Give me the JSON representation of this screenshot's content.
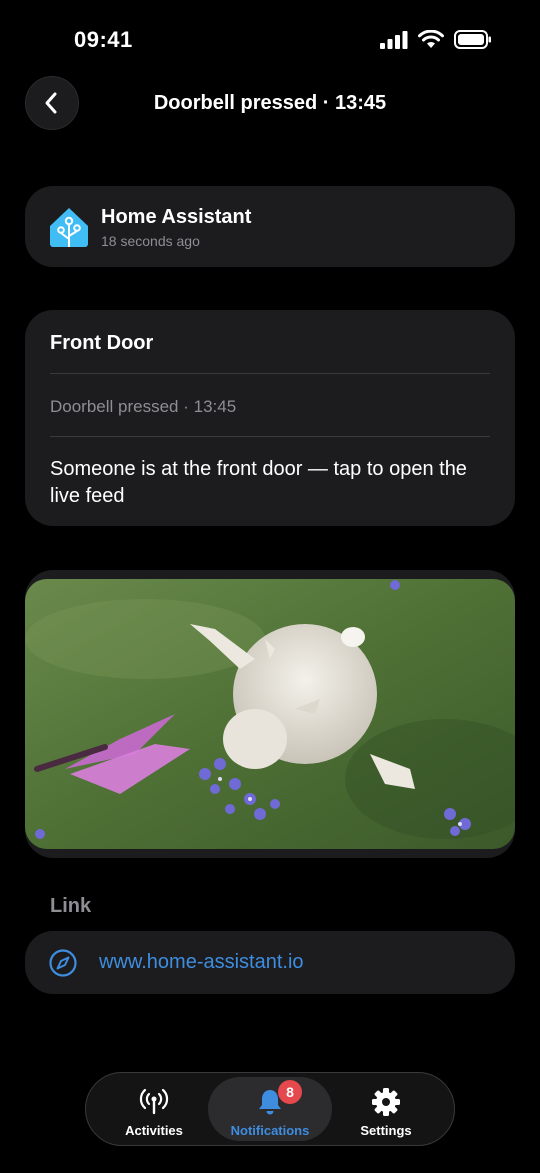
{
  "status_bar": {
    "time": "09:41"
  },
  "header": {
    "title": "Doorbell pressed · 13:45"
  },
  "app": {
    "name": "Home Assistant",
    "time_ago": "18 seconds ago"
  },
  "notification": {
    "title": "Front Door",
    "subtitle": "Doorbell pressed · 13:45",
    "body": "Someone is at the front door — tap to open the live feed"
  },
  "link_section": {
    "label": "Link",
    "url": "www.home-assistant.io"
  },
  "tabs": [
    {
      "label": "Activities",
      "icon": "antenna-icon",
      "active": false
    },
    {
      "label": "Notifications",
      "icon": "bell-icon",
      "active": true,
      "badge": "8"
    },
    {
      "label": "Settings",
      "icon": "gear-icon",
      "active": false
    }
  ],
  "colors": {
    "accent": "#3e8ddf",
    "badge": "#e5484d",
    "card": "#1c1c1e",
    "background": "#000000"
  }
}
